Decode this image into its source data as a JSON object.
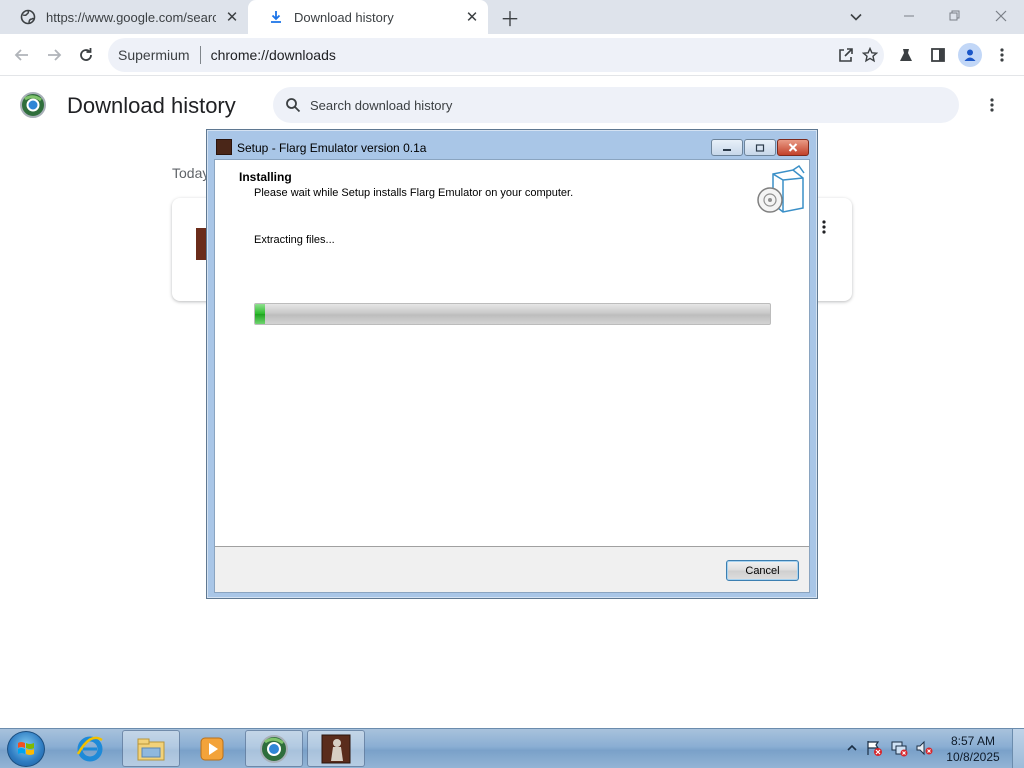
{
  "browser": {
    "tabs": [
      {
        "label": "https://www.google.com/search?q",
        "icon": "globe-icon"
      },
      {
        "label": "Download history",
        "icon": "download-icon"
      }
    ],
    "omnibox": {
      "site": "Supermium",
      "url": "chrome://downloads"
    }
  },
  "downloads_page": {
    "title": "Download history",
    "search_placeholder": "Search download history",
    "date_label": "Today"
  },
  "installer": {
    "window_title": "Setup - Flarg Emulator version 0.1a",
    "heading": "Installing",
    "subheading": "Please wait while Setup installs Flarg Emulator on your computer.",
    "status": "Extracting files...",
    "progress_fraction": 0.004,
    "cancel_label": "Cancel"
  },
  "taskbar": {
    "time": "8:57 AM",
    "date": "10/8/2025"
  },
  "colors": {
    "accent_blue": "#1a73e8",
    "progress_green": "#22b422"
  }
}
